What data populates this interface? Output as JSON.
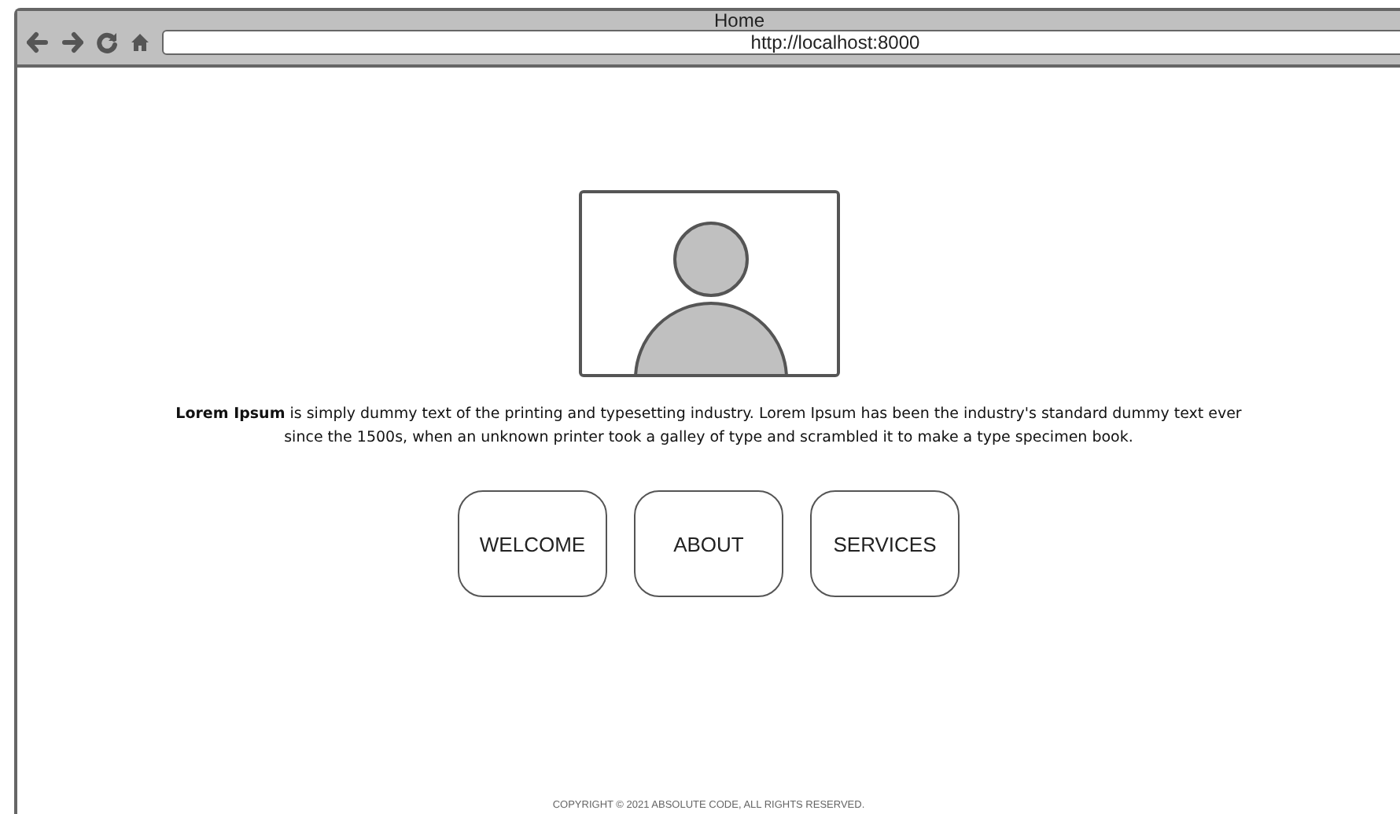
{
  "window": {
    "title": "Home",
    "url": "http://localhost:8000"
  },
  "paragraph": "**Lorem Ipsum** is simply dummy text of the printing and typesetting industry. Lorem Ipsum has been the industry's standard dummy text ever since the 1500s, when an unknown printer took a galley of type and scrambled it to make a type specimen book.",
  "buttons": [
    "WELCOME",
    "ABOUT",
    "SERVICES"
  ],
  "footer": "COPYRIGHT © 2021 ABSOLUTE CODE, ALL RIGHTS RESERVED."
}
